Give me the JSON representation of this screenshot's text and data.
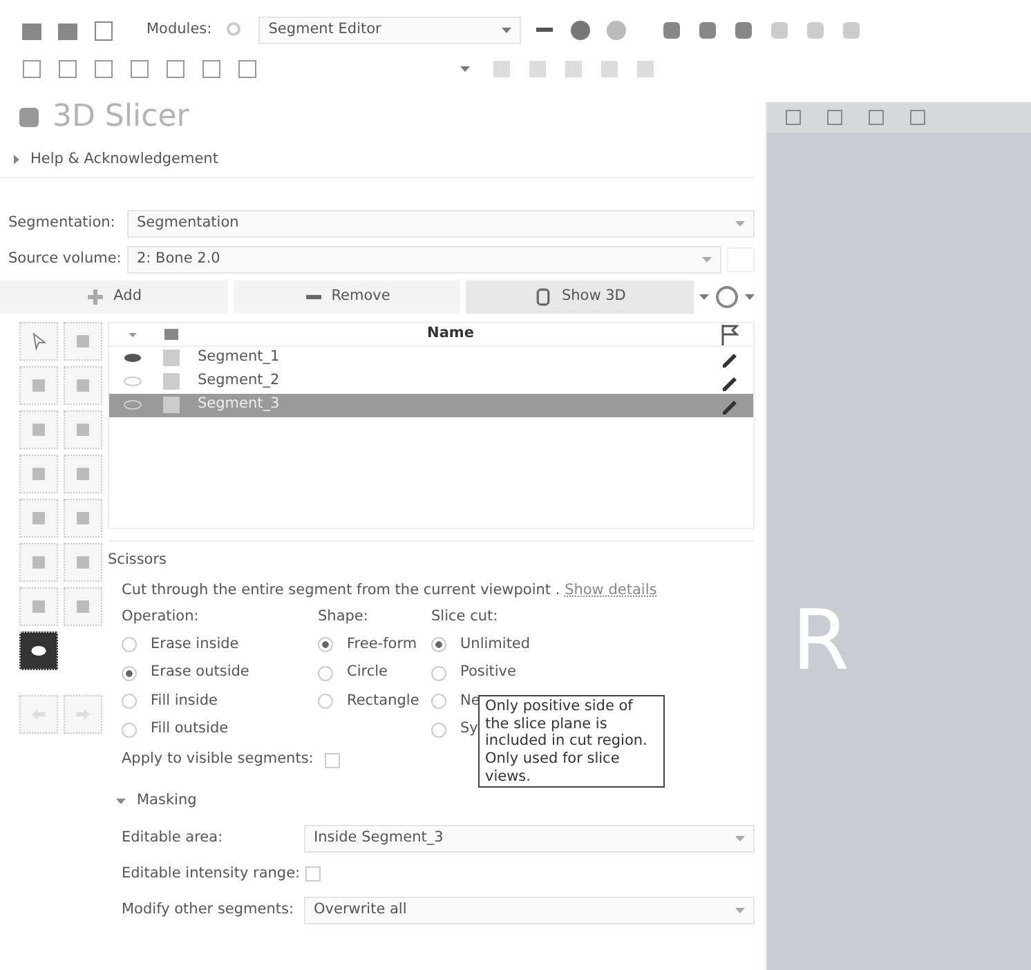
{
  "toolbar": {
    "modules_label": "Modules:",
    "module": "Segment Editor"
  },
  "logo": {
    "title": "3D Slicer"
  },
  "help": {
    "label": "Help & Acknowledgement",
    "expanded": false
  },
  "segmentation": {
    "label": "Segmentation:",
    "value": "Segmentation"
  },
  "source_volume": {
    "label": "Source volume:",
    "value": "2: Bone 2.0"
  },
  "actions": [
    {
      "kind": "add",
      "label": "Add"
    },
    {
      "kind": "remove",
      "label": "Remove"
    },
    {
      "kind": "show3d",
      "label": "Show 3D"
    }
  ],
  "segments": {
    "columns": [
      "Name"
    ],
    "rows": [
      {
        "name": "Segment_1",
        "visible": true,
        "selected": false
      },
      {
        "name": "Segment_2",
        "visible": false,
        "selected": false
      },
      {
        "name": "Segment_3",
        "visible": false,
        "selected": true
      }
    ]
  },
  "effects": [
    {
      "kind": "pointer",
      "selected": false
    },
    {
      "kind": "threshold",
      "selected": false
    },
    {
      "kind": "paint",
      "selected": false
    },
    {
      "kind": "draw",
      "selected": false
    },
    {
      "kind": "erase",
      "selected": false
    },
    {
      "kind": "levelset",
      "selected": false
    },
    {
      "kind": "grow",
      "selected": false
    },
    {
      "kind": "margin",
      "selected": false
    },
    {
      "kind": "hollow",
      "selected": false
    },
    {
      "kind": "smoothing",
      "selected": false
    },
    {
      "kind": "islands",
      "selected": false
    },
    {
      "kind": "scissors2",
      "selected": false
    },
    {
      "kind": "logical",
      "selected": false
    },
    {
      "kind": "mask",
      "selected": false
    },
    {
      "kind": "scissors",
      "selected": true
    }
  ],
  "effect": {
    "title": "Scissors",
    "description": "Cut through the entire segment from the current viewpoint .",
    "details_link": "Show details",
    "operation": {
      "label": "Operation:",
      "options": [
        {
          "label": "Erase inside",
          "selected": false
        },
        {
          "label": "Erase outside",
          "selected": true
        },
        {
          "label": "Fill inside",
          "selected": false
        },
        {
          "label": "Fill outside",
          "selected": false
        }
      ]
    },
    "shape": {
      "label": "Shape:",
      "options": [
        {
          "label": "Free-form",
          "selected": true
        },
        {
          "label": "Circle",
          "selected": false
        },
        {
          "label": "Rectangle",
          "selected": false
        }
      ]
    },
    "slice_cut": {
      "label": "Slice cut:",
      "options": [
        {
          "label": "Unlimited",
          "selected": true
        },
        {
          "label": "Positive",
          "selected": false
        },
        {
          "label": "Ne",
          "selected": false
        },
        {
          "label": "Sy",
          "selected": false
        }
      ]
    },
    "apply_visible": {
      "label": "Apply to visible segments:",
      "checked": false
    },
    "tooltip": "Only positive side of the slice plane is included in cut region. Only used for slice views."
  },
  "masking": {
    "title": "Masking",
    "expanded": true,
    "editable_area": {
      "label": "Editable area:",
      "value": "Inside Segment_3"
    },
    "intensity": {
      "label": "Editable intensity range:",
      "checked": false
    },
    "modify_other": {
      "label": "Modify other segments:",
      "value": "Overwrite all"
    }
  },
  "view": {
    "orientation_label": "R"
  }
}
